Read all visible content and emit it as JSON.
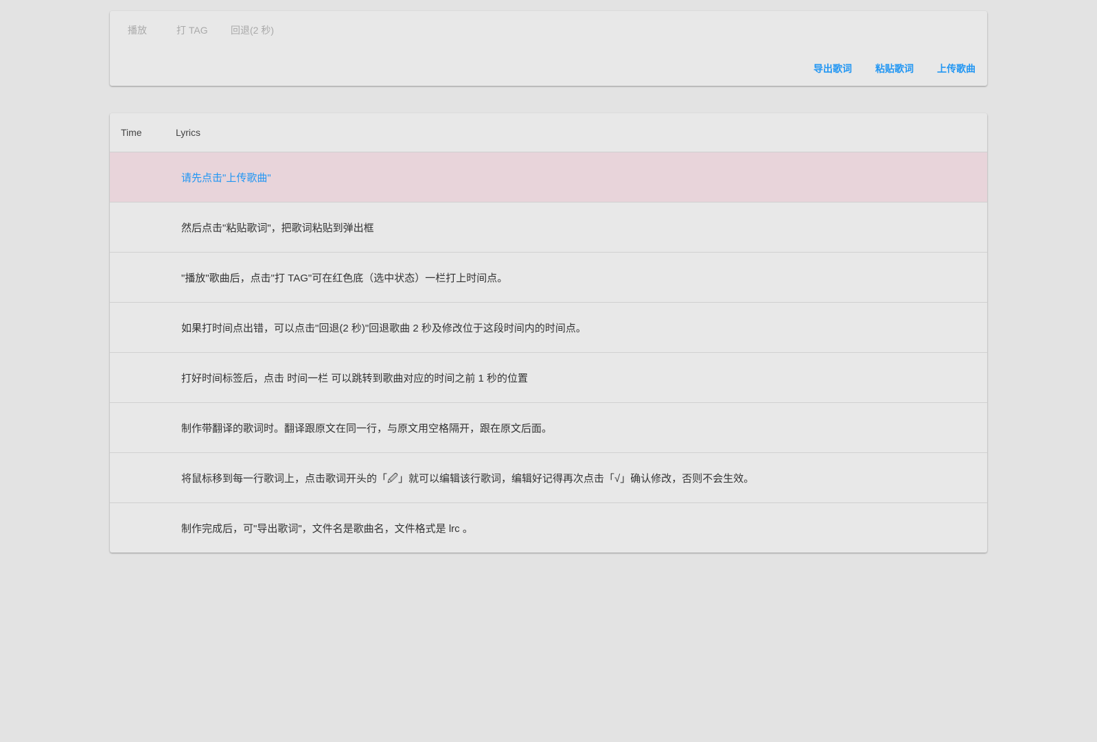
{
  "toolbar": {
    "play_label": "播放",
    "tag_label": "打 TAG",
    "rewind_label": "回退(2 秒)",
    "export_label": "导出歌词",
    "paste_label": "粘贴歌词",
    "upload_label": "上传歌曲"
  },
  "table": {
    "headers": {
      "time": "Time",
      "lyrics": "Lyrics"
    },
    "rows": [
      {
        "time": "",
        "lyric": "请先点击\"上传歌曲\""
      },
      {
        "time": "",
        "lyric": "然后点击\"粘贴歌词\"，把歌词粘贴到弹出框"
      },
      {
        "time": "",
        "lyric": "\"播放\"歌曲后，点击\"打 TAG\"可在红色底（选中状态）一栏打上时间点。"
      },
      {
        "time": "",
        "lyric": "如果打时间点出错，可以点击\"回退(2 秒)\"回退歌曲 2 秒及修改位于这段时间内的时间点。"
      },
      {
        "time": "",
        "lyric": "打好时间标签后，点击 时间一栏 可以跳转到歌曲对应的时间之前 1 秒的位置"
      },
      {
        "time": "",
        "lyric": "制作带翻译的歌词时。翻译跟原文在同一行，与原文用空格隔开，跟在原文后面。"
      },
      {
        "time": "",
        "lyric": "将鼠标移到每一行歌词上，点击歌词开头的「🖉」就可以编辑该行歌词，编辑好记得再次点击「√」确认修改，否则不会生效。"
      },
      {
        "time": "",
        "lyric": "制作完成后，可\"导出歌词\"，文件名是歌曲名，文件格式是 lrc 。"
      }
    ]
  },
  "colors": {
    "accent": "#2196f3",
    "selected_row": "#e8d4da"
  }
}
